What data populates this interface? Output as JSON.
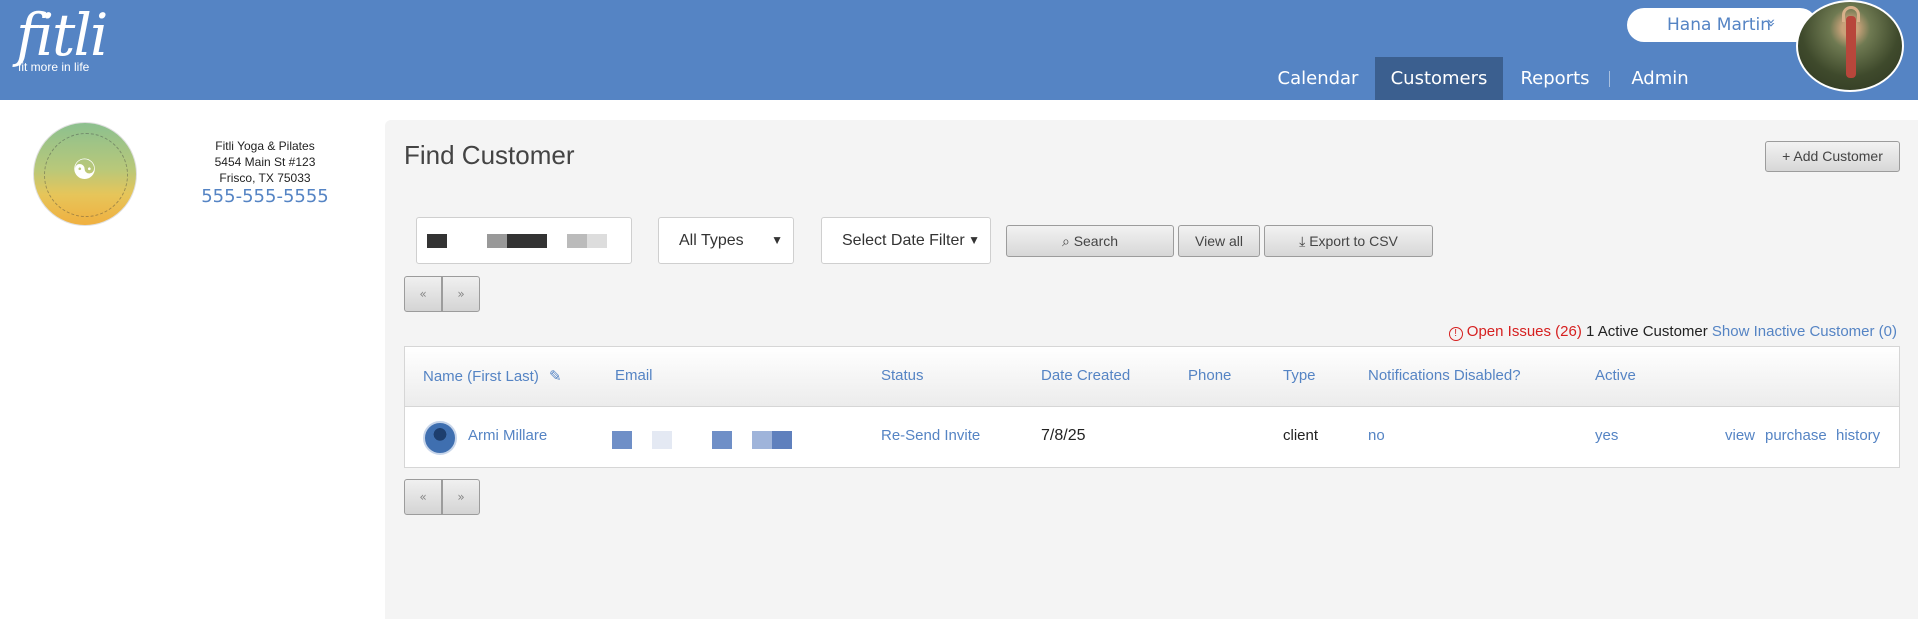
{
  "header": {
    "logo_word": "fitli",
    "logo_tagline": "fit more in life",
    "user_name": "Hana Martin",
    "user_caret": "»",
    "nav": [
      {
        "label": "Calendar",
        "active": false
      },
      {
        "label": "Customers",
        "active": true
      },
      {
        "label": "Reports",
        "active": false
      },
      {
        "label": "Admin",
        "active": false
      }
    ]
  },
  "studio": {
    "name": "Fitli Yoga & Pilates",
    "address_line1": "5454 Main St #123",
    "address_line2": "Frisco, TX 75033",
    "phone": "555-555-5555"
  },
  "page": {
    "title": "Find Customer",
    "add_button": "+ Add Customer"
  },
  "filters": {
    "type_select": "All Types",
    "date_select": "Select Date Filter",
    "search_button": "Search",
    "view_all_button": "View all",
    "export_button": "Export to CSV"
  },
  "pager": {
    "prev": "«",
    "next": "»"
  },
  "summary": {
    "issues_icon": "!",
    "issues_label": "Open Issues (26)",
    "active_count": "1 Active Customer",
    "inactive_link": "Show Inactive Customer (0)"
  },
  "table": {
    "headers": {
      "name": "Name (First Last)",
      "email": "Email",
      "status": "Status",
      "date_created": "Date Created",
      "phone": "Phone",
      "type": "Type",
      "notifications": "Notifications Disabled?",
      "active": "Active"
    },
    "rows": [
      {
        "name": "Armi Millare",
        "status": "Re-Send Invite",
        "date_created": "7/8/25",
        "phone": "",
        "type": "client",
        "notifications": "no",
        "active": "yes",
        "actions": {
          "view": "view",
          "purchase": "purchase",
          "history": "history"
        }
      }
    ]
  },
  "colors": {
    "header_bg": "#5584c4",
    "nav_active_bg": "#3b5f8f",
    "link": "#5584c4",
    "issues": "#d62020",
    "panel_bg": "#f4f4f4"
  },
  "icons": {
    "edit": "pencil-icon",
    "search": "magnifier-icon",
    "export": "download-icon",
    "alert": "alert-circle-icon"
  }
}
